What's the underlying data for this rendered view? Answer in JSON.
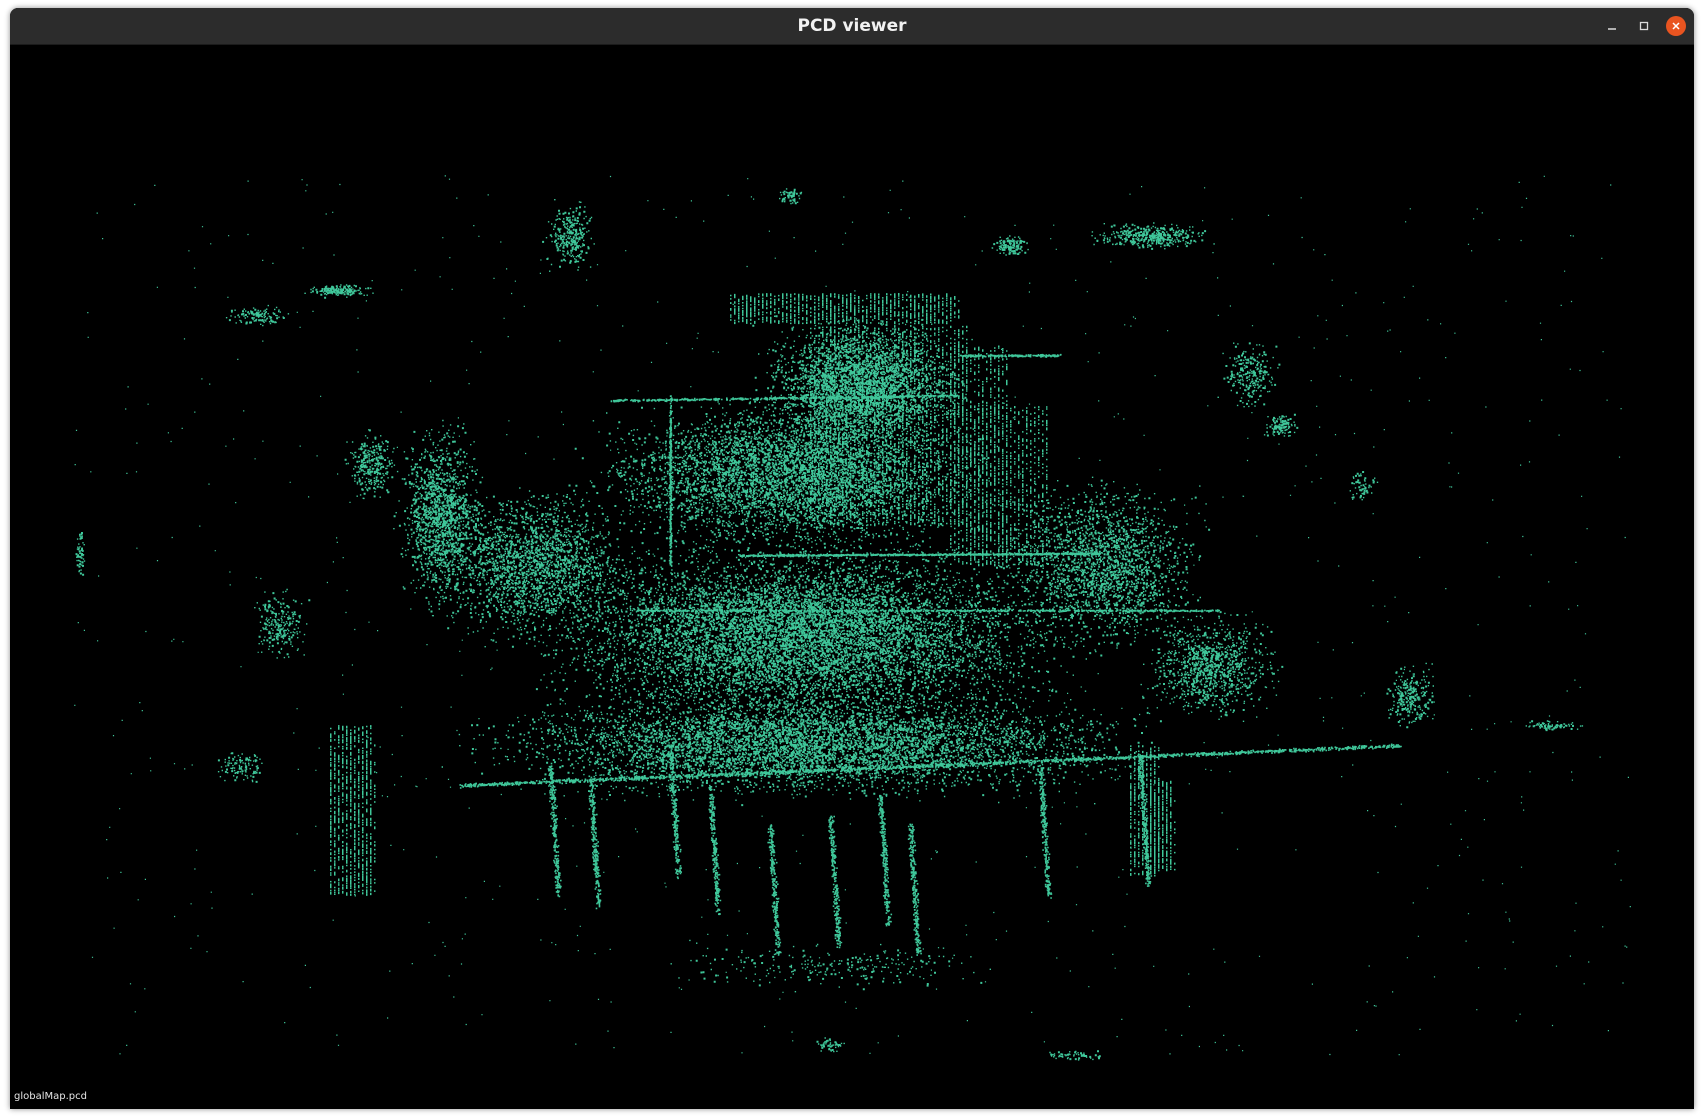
{
  "window": {
    "title": "PCD viewer",
    "controls": [
      "minimize-icon",
      "maximize-icon",
      "close-icon"
    ]
  },
  "viewer": {
    "background_color": "#000000",
    "point_color": "#3fc79a",
    "cloud_label": "globalMap.pcd"
  },
  "colors": {
    "titlebar": "#2c2c2c",
    "title_text": "#f2f2f2",
    "close_button": "#e95420"
  }
}
